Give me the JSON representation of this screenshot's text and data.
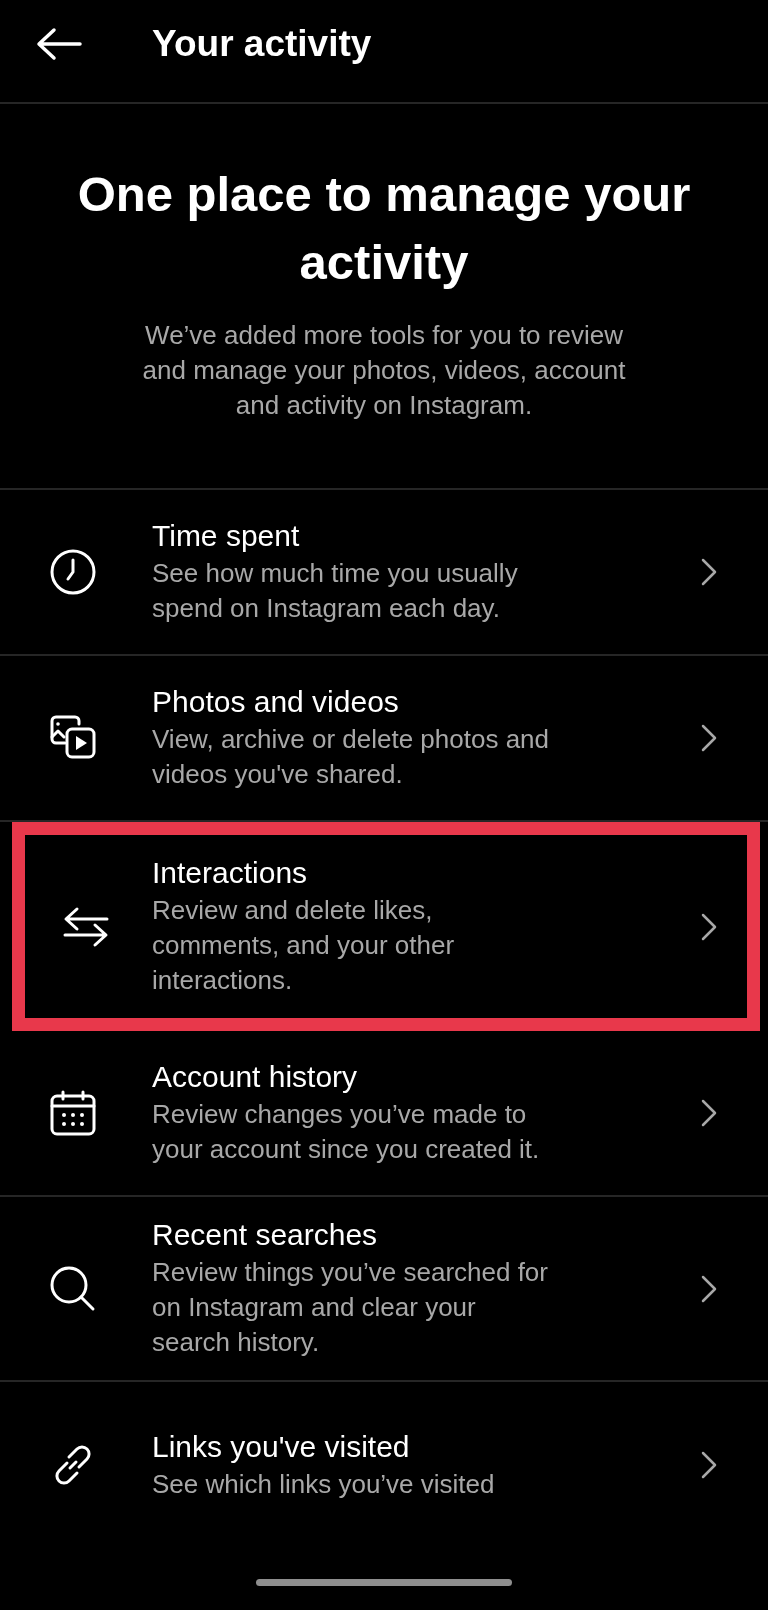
{
  "header": {
    "title": "Your activity"
  },
  "intro": {
    "heading": "One place to manage your activity",
    "text": "We’ve added more tools for you to review and manage your photos, videos, account and activity on Instagram."
  },
  "items": [
    {
      "title": "Time spent",
      "description": "See how much time you usually spend on Instagram each day.",
      "highlighted": false
    },
    {
      "title": "Photos and videos",
      "description": "View, archive or delete photos and videos you've shared.",
      "highlighted": false
    },
    {
      "title": "Interactions",
      "description": "Review and delete likes, comments, and your other interactions.",
      "highlighted": true
    },
    {
      "title": "Account history",
      "description": "Review changes you’ve made to your account since you created it.",
      "highlighted": false
    },
    {
      "title": "Recent searches",
      "description": "Review things you’ve searched for on Instagram and clear your search history.",
      "highlighted": false
    },
    {
      "title": "Links you've visited",
      "description": "See which links you’ve visited",
      "highlighted": false
    }
  ]
}
